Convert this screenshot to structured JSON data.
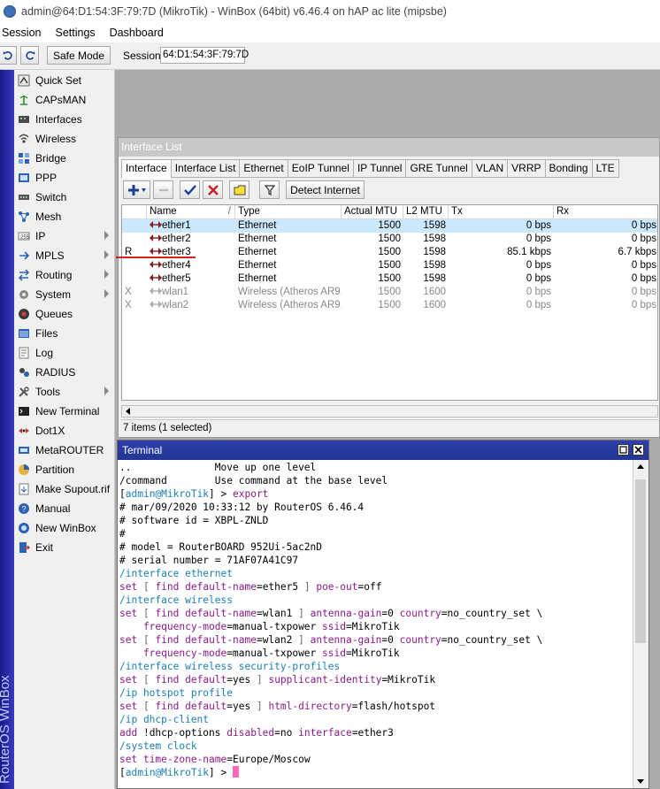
{
  "window": {
    "title": "admin@64:D1:54:3F:79:7D (MikroTik) - WinBox (64bit) v6.46.4 on hAP ac lite (mipsbe)"
  },
  "menubar": {
    "items": [
      "Session",
      "Settings",
      "Dashboard"
    ]
  },
  "toolbar": {
    "safe_mode": "Safe Mode",
    "session_label": "Session:",
    "session_value": "64:D1:54:3F:79:7D"
  },
  "brand_vertical": "RouterOS WinBox",
  "sidebar": {
    "items": [
      {
        "label": "Quick Set",
        "icon": "quickset-icon",
        "submenu": false
      },
      {
        "label": "CAPsMAN",
        "icon": "capsman-icon",
        "submenu": false
      },
      {
        "label": "Interfaces",
        "icon": "interfaces-icon",
        "submenu": false
      },
      {
        "label": "Wireless",
        "icon": "wireless-icon",
        "submenu": false
      },
      {
        "label": "Bridge",
        "icon": "bridge-icon",
        "submenu": false
      },
      {
        "label": "PPP",
        "icon": "ppp-icon",
        "submenu": false
      },
      {
        "label": "Switch",
        "icon": "switch-icon",
        "submenu": false
      },
      {
        "label": "Mesh",
        "icon": "mesh-icon",
        "submenu": false
      },
      {
        "label": "IP",
        "icon": "ip-icon",
        "submenu": true
      },
      {
        "label": "MPLS",
        "icon": "mpls-icon",
        "submenu": true
      },
      {
        "label": "Routing",
        "icon": "routing-icon",
        "submenu": true
      },
      {
        "label": "System",
        "icon": "system-icon",
        "submenu": true
      },
      {
        "label": "Queues",
        "icon": "queues-icon",
        "submenu": false
      },
      {
        "label": "Files",
        "icon": "files-icon",
        "submenu": false
      },
      {
        "label": "Log",
        "icon": "log-icon",
        "submenu": false
      },
      {
        "label": "RADIUS",
        "icon": "radius-icon",
        "submenu": false
      },
      {
        "label": "Tools",
        "icon": "tools-icon",
        "submenu": true
      },
      {
        "label": "New Terminal",
        "icon": "terminal-icon",
        "submenu": false
      },
      {
        "label": "Dot1X",
        "icon": "dot1x-icon",
        "submenu": false
      },
      {
        "label": "MetaROUTER",
        "icon": "metarouter-icon",
        "submenu": false
      },
      {
        "label": "Partition",
        "icon": "partition-icon",
        "submenu": false
      },
      {
        "label": "Make Supout.rif",
        "icon": "supout-icon",
        "submenu": false
      },
      {
        "label": "Manual",
        "icon": "manual-icon",
        "submenu": false
      },
      {
        "label": "New WinBox",
        "icon": "winbox-icon",
        "submenu": false
      },
      {
        "label": "Exit",
        "icon": "exit-icon",
        "submenu": false
      }
    ]
  },
  "interface_list": {
    "title": "Interface List",
    "tabs": [
      "Interface",
      "Interface List",
      "Ethernet",
      "EoIP Tunnel",
      "IP Tunnel",
      "GRE Tunnel",
      "VLAN",
      "VRRP",
      "Bonding",
      "LTE"
    ],
    "active_tab": "Interface",
    "detect_button": "Detect Internet",
    "columns": [
      "",
      "Name",
      "Type",
      "Actual MTU",
      "L2 MTU",
      "Tx",
      "Rx"
    ],
    "rows": [
      {
        "flag": "",
        "name": "ether1",
        "type": "Ethernet",
        "mtu": "1500",
        "l2mtu": "1598",
        "tx": "0 bps",
        "rx": "0 bps",
        "selected": true,
        "disabled": false
      },
      {
        "flag": "",
        "name": "ether2",
        "type": "Ethernet",
        "mtu": "1500",
        "l2mtu": "1598",
        "tx": "0 bps",
        "rx": "0 bps",
        "selected": false,
        "disabled": false
      },
      {
        "flag": "R",
        "name": "ether3",
        "type": "Ethernet",
        "mtu": "1500",
        "l2mtu": "1598",
        "tx": "85.1 kbps",
        "rx": "6.7 kbps",
        "selected": false,
        "disabled": false
      },
      {
        "flag": "",
        "name": "ether4",
        "type": "Ethernet",
        "mtu": "1500",
        "l2mtu": "1598",
        "tx": "0 bps",
        "rx": "0 bps",
        "selected": false,
        "disabled": false
      },
      {
        "flag": "",
        "name": "ether5",
        "type": "Ethernet",
        "mtu": "1500",
        "l2mtu": "1598",
        "tx": "0 bps",
        "rx": "0 bps",
        "selected": false,
        "disabled": false
      },
      {
        "flag": "X",
        "name": "wlan1",
        "type": "Wireless (Atheros AR9...",
        "mtu": "1500",
        "l2mtu": "1600",
        "tx": "0 bps",
        "rx": "0 bps",
        "selected": false,
        "disabled": true
      },
      {
        "flag": "X",
        "name": "wlan2",
        "type": "Wireless (Atheros AR9...",
        "mtu": "1500",
        "l2mtu": "1600",
        "tx": "0 bps",
        "rx": "0 bps",
        "selected": false,
        "disabled": true
      }
    ],
    "status": "7 items (1 selected)"
  },
  "terminal": {
    "title": "Terminal",
    "lines": [
      [
        {
          "t": "..              Move up one level",
          "c": ""
        }
      ],
      [
        {
          "t": "/command        Use command at the base level",
          "c": ""
        }
      ],
      [
        {
          "t": "[",
          "c": ""
        },
        {
          "t": "admin@MikroTik",
          "c": "c-blue"
        },
        {
          "t": "] > ",
          "c": ""
        },
        {
          "t": "export",
          "c": "c-kw"
        }
      ],
      [
        {
          "t": "# mar/09/2020 10:33:12 by RouterOS 6.46.4",
          "c": ""
        }
      ],
      [
        {
          "t": "# software id = XBPL-ZNLD",
          "c": ""
        }
      ],
      [
        {
          "t": "#",
          "c": ""
        }
      ],
      [
        {
          "t": "# model = RouterBOARD 952Ui-5ac2nD",
          "c": ""
        }
      ],
      [
        {
          "t": "# serial number = 71AF07A41C97",
          "c": ""
        }
      ],
      [
        {
          "t": "/interface ethernet",
          "c": "c-blue"
        }
      ],
      [
        {
          "t": "set",
          "c": "c-kw"
        },
        {
          "t": " [ ",
          "c": "c-br"
        },
        {
          "t": "find",
          "c": "c-kw"
        },
        {
          "t": " default-name",
          "c": "c-kw"
        },
        {
          "t": "=ether5 ",
          "c": ""
        },
        {
          "t": "] ",
          "c": "c-br"
        },
        {
          "t": "poe-out",
          "c": "c-kw"
        },
        {
          "t": "=off",
          "c": ""
        }
      ],
      [
        {
          "t": "/interface wireless",
          "c": "c-blue"
        }
      ],
      [
        {
          "t": "set",
          "c": "c-kw"
        },
        {
          "t": " [ ",
          "c": "c-br"
        },
        {
          "t": "find",
          "c": "c-kw"
        },
        {
          "t": " default-name",
          "c": "c-kw"
        },
        {
          "t": "=wlan1 ",
          "c": ""
        },
        {
          "t": "] ",
          "c": "c-br"
        },
        {
          "t": "antenna-gain",
          "c": "c-kw"
        },
        {
          "t": "=0 ",
          "c": ""
        },
        {
          "t": "country",
          "c": "c-kw"
        },
        {
          "t": "=no_country_set \\",
          "c": ""
        }
      ],
      [
        {
          "t": "    frequency-mode",
          "c": "c-kw"
        },
        {
          "t": "=manual-txpower ",
          "c": ""
        },
        {
          "t": "ssid",
          "c": "c-kw"
        },
        {
          "t": "=MikroTik",
          "c": ""
        }
      ],
      [
        {
          "t": "set",
          "c": "c-kw"
        },
        {
          "t": " [ ",
          "c": "c-br"
        },
        {
          "t": "find",
          "c": "c-kw"
        },
        {
          "t": " default-name",
          "c": "c-kw"
        },
        {
          "t": "=wlan2 ",
          "c": ""
        },
        {
          "t": "] ",
          "c": "c-br"
        },
        {
          "t": "antenna-gain",
          "c": "c-kw"
        },
        {
          "t": "=0 ",
          "c": ""
        },
        {
          "t": "country",
          "c": "c-kw"
        },
        {
          "t": "=no_country_set \\",
          "c": ""
        }
      ],
      [
        {
          "t": "    frequency-mode",
          "c": "c-kw"
        },
        {
          "t": "=manual-txpower ",
          "c": ""
        },
        {
          "t": "ssid",
          "c": "c-kw"
        },
        {
          "t": "=MikroTik",
          "c": ""
        }
      ],
      [
        {
          "t": "/interface wireless security-profiles",
          "c": "c-blue"
        }
      ],
      [
        {
          "t": "set",
          "c": "c-kw"
        },
        {
          "t": " [ ",
          "c": "c-br"
        },
        {
          "t": "find",
          "c": "c-kw"
        },
        {
          "t": " default",
          "c": "c-kw"
        },
        {
          "t": "=yes ",
          "c": ""
        },
        {
          "t": "] ",
          "c": "c-br"
        },
        {
          "t": "supplicant-identity",
          "c": "c-kw"
        },
        {
          "t": "=MikroTik",
          "c": ""
        }
      ],
      [
        {
          "t": "/ip hotspot profile",
          "c": "c-blue"
        }
      ],
      [
        {
          "t": "set",
          "c": "c-kw"
        },
        {
          "t": " [ ",
          "c": "c-br"
        },
        {
          "t": "find",
          "c": "c-kw"
        },
        {
          "t": " default",
          "c": "c-kw"
        },
        {
          "t": "=yes ",
          "c": ""
        },
        {
          "t": "] ",
          "c": "c-br"
        },
        {
          "t": "html-directory",
          "c": "c-kw"
        },
        {
          "t": "=flash/hotspot",
          "c": ""
        }
      ],
      [
        {
          "t": "/ip dhcp-client",
          "c": "c-blue"
        }
      ],
      [
        {
          "t": "add",
          "c": "c-kw"
        },
        {
          "t": " !dhcp-options ",
          "c": ""
        },
        {
          "t": "disabled",
          "c": "c-kw"
        },
        {
          "t": "=no ",
          "c": ""
        },
        {
          "t": "interface",
          "c": "c-kw"
        },
        {
          "t": "=ether3",
          "c": ""
        }
      ],
      [
        {
          "t": "/system clock",
          "c": "c-blue"
        }
      ],
      [
        {
          "t": "set",
          "c": "c-kw"
        },
        {
          "t": " time-zone-name",
          "c": "c-kw"
        },
        {
          "t": "=Europe/Moscow",
          "c": ""
        }
      ],
      [
        {
          "t": "[",
          "c": ""
        },
        {
          "t": "admin@MikroTik",
          "c": "c-blue"
        },
        {
          "t": "] > ",
          "c": ""
        }
      ]
    ]
  }
}
